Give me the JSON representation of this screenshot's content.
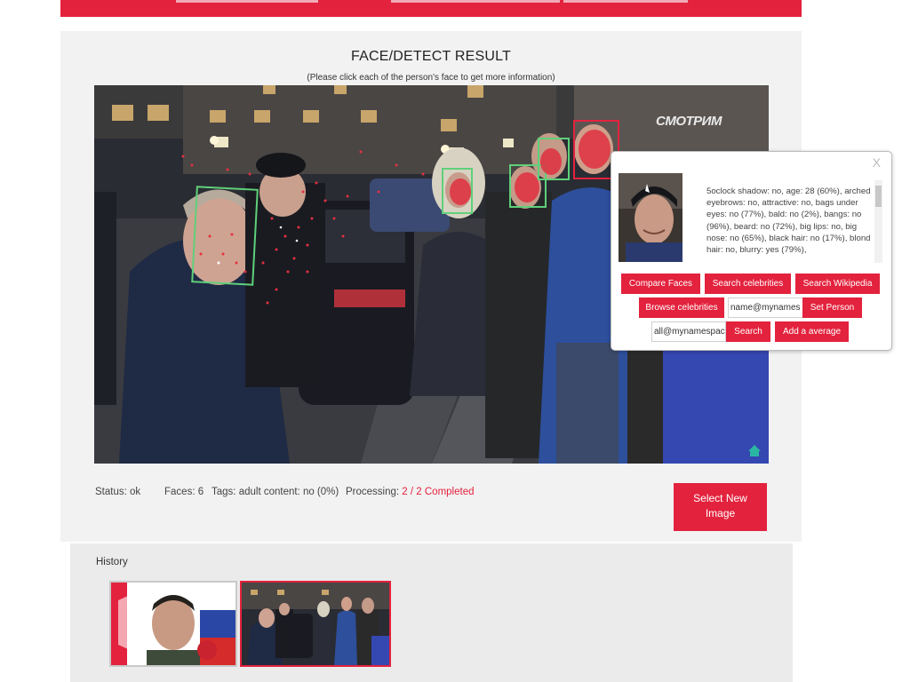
{
  "page": {
    "title": "FACE/DETECT RESULT",
    "subtitle": "(Please click each of the person's face to get more information)"
  },
  "scene": {
    "watermark": "СМОТРИМ"
  },
  "popup": {
    "close_label": "X",
    "info": "5oclock shadow: no, age: 28 (60%), arched eyebrows: no, attractive: no, bags under eyes: no (77%), bald: no (2%), bangs: no (96%), beard: no (72%), big lips: no, big nose: no (65%), black hair: no (17%), blond hair: no, blurry: yes (79%),",
    "buttons": {
      "compare": "Compare Faces",
      "search_celebs": "Search celebrities",
      "search_wiki": "Search Wikipedia",
      "browse_celebs": "Browse celebrities",
      "set_person": "Set Person",
      "search": "Search",
      "add_average": "Add a average"
    },
    "inputs": {
      "name_value": "name@mynames",
      "space_value": "all@mynamespac"
    }
  },
  "status": {
    "status_label": "Status:",
    "status_value": "ok",
    "faces_label": "Faces:",
    "faces_value": "6",
    "tags_label": "Tags:",
    "tags_value": "adult content: no (0%)",
    "processing_label": "Processing:",
    "processing_value": "2 / 2 Completed"
  },
  "select_button": {
    "line1": "Select New",
    "line2": "Image"
  },
  "history": {
    "label": "History"
  },
  "colors": {
    "accent": "#e3223d",
    "face_box": "#5fd07a",
    "panel_bg": "#f2f2f2"
  }
}
